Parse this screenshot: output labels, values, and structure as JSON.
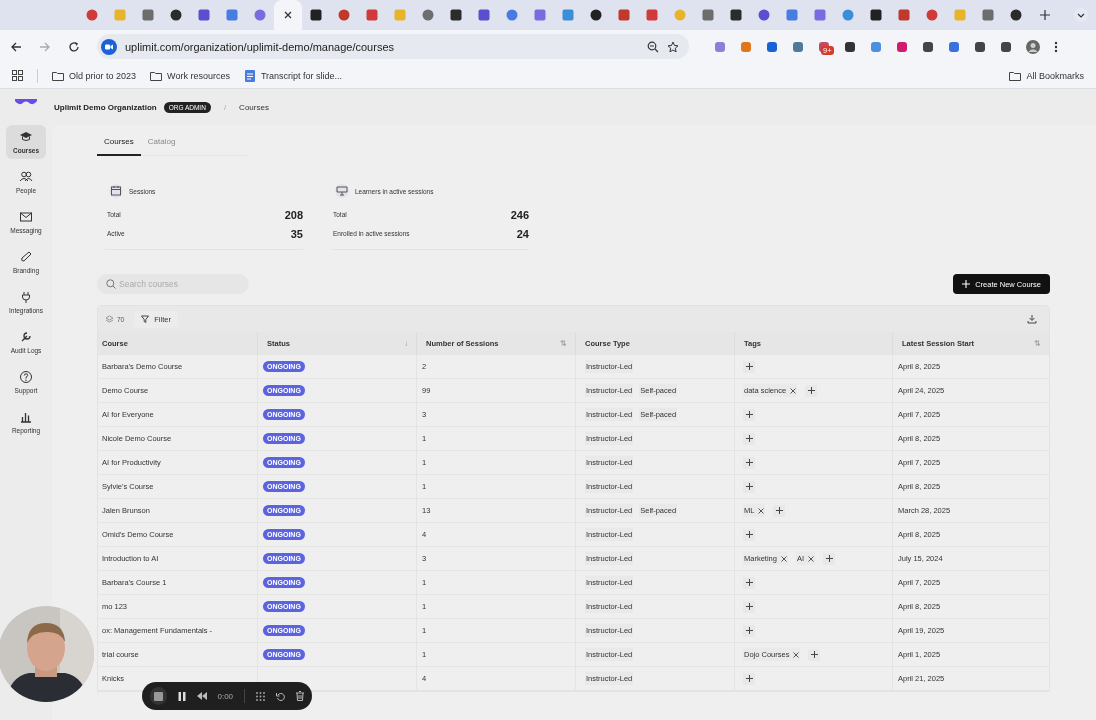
{
  "browser": {
    "tabs": [
      {
        "selected": false
      },
      {
        "selected": false
      },
      {
        "selected": false
      },
      {
        "selected": false
      },
      {
        "selected": false
      },
      {
        "selected": false
      },
      {
        "selected": false
      },
      {
        "selected": true
      },
      {
        "selected": false
      },
      {
        "selected": false
      },
      {
        "selected": false
      },
      {
        "selected": false
      },
      {
        "selected": false
      },
      {
        "selected": false
      },
      {
        "selected": false
      },
      {
        "selected": false
      },
      {
        "selected": false
      },
      {
        "selected": false
      },
      {
        "selected": false
      },
      {
        "selected": false
      },
      {
        "selected": false
      },
      {
        "selected": false
      },
      {
        "selected": false
      },
      {
        "selected": false
      },
      {
        "selected": false
      },
      {
        "selected": false
      },
      {
        "selected": false
      },
      {
        "selected": false
      },
      {
        "selected": false
      },
      {
        "selected": false
      },
      {
        "selected": false
      },
      {
        "selected": false
      },
      {
        "selected": false
      },
      {
        "selected": false
      }
    ],
    "address": "uplimit.com/organization/uplimit-demo/manage/courses",
    "extension_badge": "9+",
    "bookmarks": [
      {
        "label": "Old prior to 2023",
        "kind": "folder"
      },
      {
        "label": "Work resources",
        "kind": "folder"
      },
      {
        "label": "Transcript for slide...",
        "kind": "doc"
      }
    ],
    "all_bookmarks": "All Bookmarks"
  },
  "sidebar": {
    "items": [
      {
        "label": "Courses",
        "kind": "cap",
        "selected": true
      },
      {
        "label": "People",
        "kind": "people",
        "selected": false
      },
      {
        "label": "Messaging",
        "kind": "mail",
        "selected": false
      },
      {
        "label": "Branding",
        "kind": "brush",
        "selected": false
      },
      {
        "label": "Integrations",
        "kind": "plug",
        "selected": false
      },
      {
        "label": "Audit Logs",
        "kind": "tool",
        "selected": false
      },
      {
        "label": "Support",
        "kind": "help",
        "selected": false
      },
      {
        "label": "Reporting",
        "kind": "chart",
        "selected": false
      }
    ]
  },
  "header": {
    "org": "Uplimit Demo Organization",
    "role_badge": "ORG ADMIN",
    "separator": "/",
    "page": "Courses"
  },
  "page_tabs": [
    {
      "label": "Courses",
      "selected": true
    },
    {
      "label": "Catalog",
      "selected": false
    }
  ],
  "stats": [
    {
      "title": "Sessions",
      "kind": "sessions",
      "rows": [
        {
          "label": "Total",
          "value": "208"
        },
        {
          "label": "Active",
          "value": "35"
        }
      ]
    },
    {
      "title": "Learners in active sessions",
      "kind": "learners",
      "rows": [
        {
          "label": "Total",
          "value": "246"
        },
        {
          "label": "Enrolled in active sessions",
          "value": "24"
        }
      ]
    }
  ],
  "search": {
    "placeholder": "Search courses"
  },
  "create_button": "Create New Course",
  "table": {
    "count": "70",
    "filter": "Filter",
    "columns": [
      {
        "label": "Course"
      },
      {
        "label": "Status",
        "sort_glyph": "↓"
      },
      {
        "label": "Number of Sessions",
        "sort_glyph": "⇅"
      },
      {
        "label": "Course Type"
      },
      {
        "label": "Tags"
      },
      {
        "label": "Latest Session Start",
        "sort_glyph": "⇅"
      }
    ],
    "rows": [
      {
        "course": "Barbara's Demo Course",
        "status": "ONGOING",
        "sessions": "2",
        "types": [
          "Instructor-Led"
        ],
        "tags": [],
        "latest": "April 8, 2025"
      },
      {
        "course": "Demo Course",
        "status": "ONGOING",
        "sessions": "99",
        "types": [
          "Instructor-Led",
          "Self-paced"
        ],
        "tags": [
          "data science"
        ],
        "latest": "April 24, 2025"
      },
      {
        "course": "AI for Everyone",
        "status": "ONGOING",
        "sessions": "3",
        "types": [
          "Instructor-Led",
          "Self-paced"
        ],
        "tags": [],
        "latest": "April 7, 2025"
      },
      {
        "course": "Nicole Demo Course",
        "status": "ONGOING",
        "sessions": "1",
        "types": [
          "Instructor-Led"
        ],
        "tags": [],
        "latest": "April 8, 2025"
      },
      {
        "course": "AI for Productivity",
        "status": "ONGOING",
        "sessions": "1",
        "types": [
          "Instructor-Led"
        ],
        "tags": [],
        "latest": "April 7, 2025"
      },
      {
        "course": "Sylvie's Course",
        "status": "ONGOING",
        "sessions": "1",
        "types": [
          "Instructor-Led"
        ],
        "tags": [],
        "latest": "April 8, 2025"
      },
      {
        "course": "Jalen Brunson",
        "status": "ONGOING",
        "sessions": "13",
        "types": [
          "Instructor-Led",
          "Self-paced"
        ],
        "tags": [
          "ML"
        ],
        "latest": "March 28, 2025"
      },
      {
        "course": "Omid's Demo Course",
        "status": "ONGOING",
        "sessions": "4",
        "types": [
          "Instructor-Led"
        ],
        "tags": [],
        "latest": "April 8, 2025"
      },
      {
        "course": "Introduction to AI",
        "status": "ONGOING",
        "sessions": "3",
        "types": [
          "Instructor-Led"
        ],
        "tags": [
          "Marketing",
          "AI"
        ],
        "latest": "July 15, 2024"
      },
      {
        "course": "Barbara's Course 1",
        "status": "ONGOING",
        "sessions": "1",
        "types": [
          "Instructor-Led"
        ],
        "tags": [],
        "latest": "April 7, 2025"
      },
      {
        "course": "mo 123",
        "status": "ONGOING",
        "sessions": "1",
        "types": [
          "Instructor-Led"
        ],
        "tags": [],
        "latest": "April 8, 2025"
      },
      {
        "course": "ox: Management Fundamentals -",
        "status": "ONGOING",
        "sessions": "1",
        "types": [
          "Instructor-Led"
        ],
        "tags": [],
        "latest": "April 19, 2025"
      },
      {
        "course": "trial course",
        "status": "ONGOING",
        "sessions": "1",
        "types": [
          "Instructor-Led"
        ],
        "tags": [
          "Dojo Courses"
        ],
        "latest": "April 1, 2025"
      },
      {
        "course": "Knicks",
        "sessions": "4",
        "types": [
          "Instructor-Led"
        ],
        "tags": [],
        "latest": "April 21, 2025"
      }
    ]
  },
  "recorder": {
    "time": "0:00"
  }
}
